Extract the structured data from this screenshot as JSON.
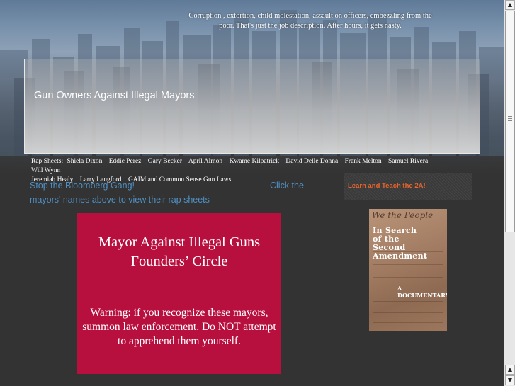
{
  "header": {
    "tagline": "Corruption , extortion, child molestation, assault on officers, embezzling from the poor.  That's just the job description. After hours, it gets nasty.",
    "site_title": "Gun Owners Against Illegal Mayors"
  },
  "rap_nav": {
    "label": "Rap Sheets:",
    "items": [
      "Shiela Dixon",
      "Eddie Perez",
      "Gary Becker",
      "April Almon",
      "Kwame Kilpatrick",
      "David Delle Donna",
      "Frank Melton",
      "Samuel Rivera",
      "Will Wynn",
      "Jeremiah Healy",
      "Larry Langford",
      "GAIM and Common Sense Gun Laws"
    ]
  },
  "intro": {
    "part_a": "Stop the Bloomberg Gang!",
    "part_b": "Click the",
    "part_c": "mayors' names above to view their rap sheets"
  },
  "sidebar": {
    "learn_link": "Learn and Teach the 2A!",
    "book": {
      "script_text": "We the People",
      "title_lines": [
        "In Search",
        "of the",
        "Second",
        "Amendment"
      ],
      "subtitle": "A DOCUMENTARY"
    }
  },
  "founders": {
    "title": "Mayor Against Illegal Guns Founders’ Circle",
    "warning": "Warning: if you recognize these mayors, summon law enforcement. Do NOT attempt to apprehend them yourself."
  },
  "colors": {
    "background": "#333333",
    "link_blue": "#4f90c4",
    "accent_orange": "#e8642a",
    "founders_red": "#b8103e"
  }
}
